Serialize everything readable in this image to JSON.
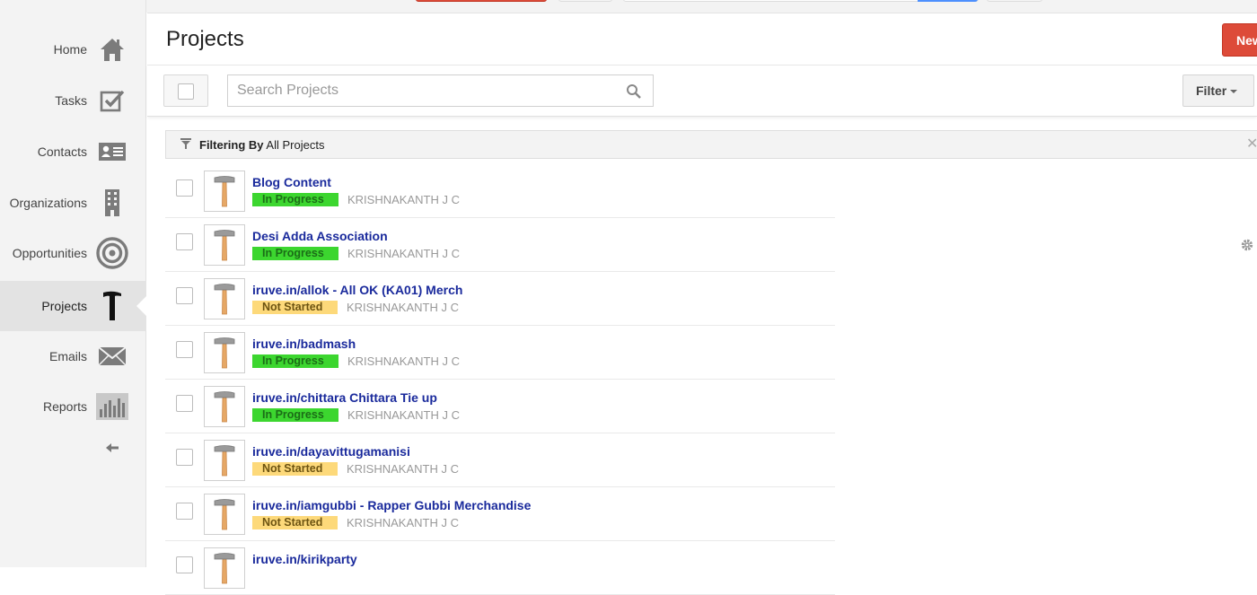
{
  "nav": {
    "items": [
      {
        "label": "Home",
        "icon": "home-icon"
      },
      {
        "label": "Tasks",
        "icon": "tasks-icon"
      },
      {
        "label": "Contacts",
        "icon": "contacts-icon"
      },
      {
        "label": "Organizations",
        "icon": "building-icon"
      },
      {
        "label": "Opportunities",
        "icon": "target-icon"
      },
      {
        "label": "Projects",
        "icon": "hammer-icon"
      },
      {
        "label": "Emails",
        "icon": "envelope-icon"
      },
      {
        "label": "Reports",
        "icon": "bar-chart-icon"
      }
    ],
    "active": "Projects",
    "collapse_icon": "arrow-left-icon"
  },
  "header": {
    "title": "Projects",
    "new_button": "New"
  },
  "toolbar": {
    "search_placeholder": "Search Projects",
    "filter_label": "Filter"
  },
  "filterbar": {
    "prefix": "Filtering By",
    "value": "All Projects"
  },
  "colors": {
    "accent_red": "#dd4b39",
    "link_blue": "#1a2a9c",
    "in_progress": "#3cd62f",
    "not_started": "#fdd97a"
  },
  "projects": [
    {
      "name": "Blog Content",
      "status": "In Progress",
      "owner": "KRISHNAKANTH J C"
    },
    {
      "name": "Desi Adda Association",
      "status": "In Progress",
      "owner": "KRISHNAKANTH J C"
    },
    {
      "name": "iruve.in/allok - All OK (KA01) Merch",
      "status": "Not Started",
      "owner": "KRISHNAKANTH J C"
    },
    {
      "name": "iruve.in/badmash",
      "status": "In Progress",
      "owner": "KRISHNAKANTH J C"
    },
    {
      "name": "iruve.in/chittara Chittara Tie up",
      "status": "In Progress",
      "owner": "KRISHNAKANTH J C"
    },
    {
      "name": "iruve.in/dayavittugamanisi",
      "status": "Not Started",
      "owner": "KRISHNAKANTH J C"
    },
    {
      "name": "iruve.in/iamgubbi - Rapper Gubbi Merchandise",
      "status": "Not Started",
      "owner": "KRISHNAKANTH J C"
    },
    {
      "name": "iruve.in/kirikparty",
      "status": "",
      "owner": ""
    }
  ]
}
